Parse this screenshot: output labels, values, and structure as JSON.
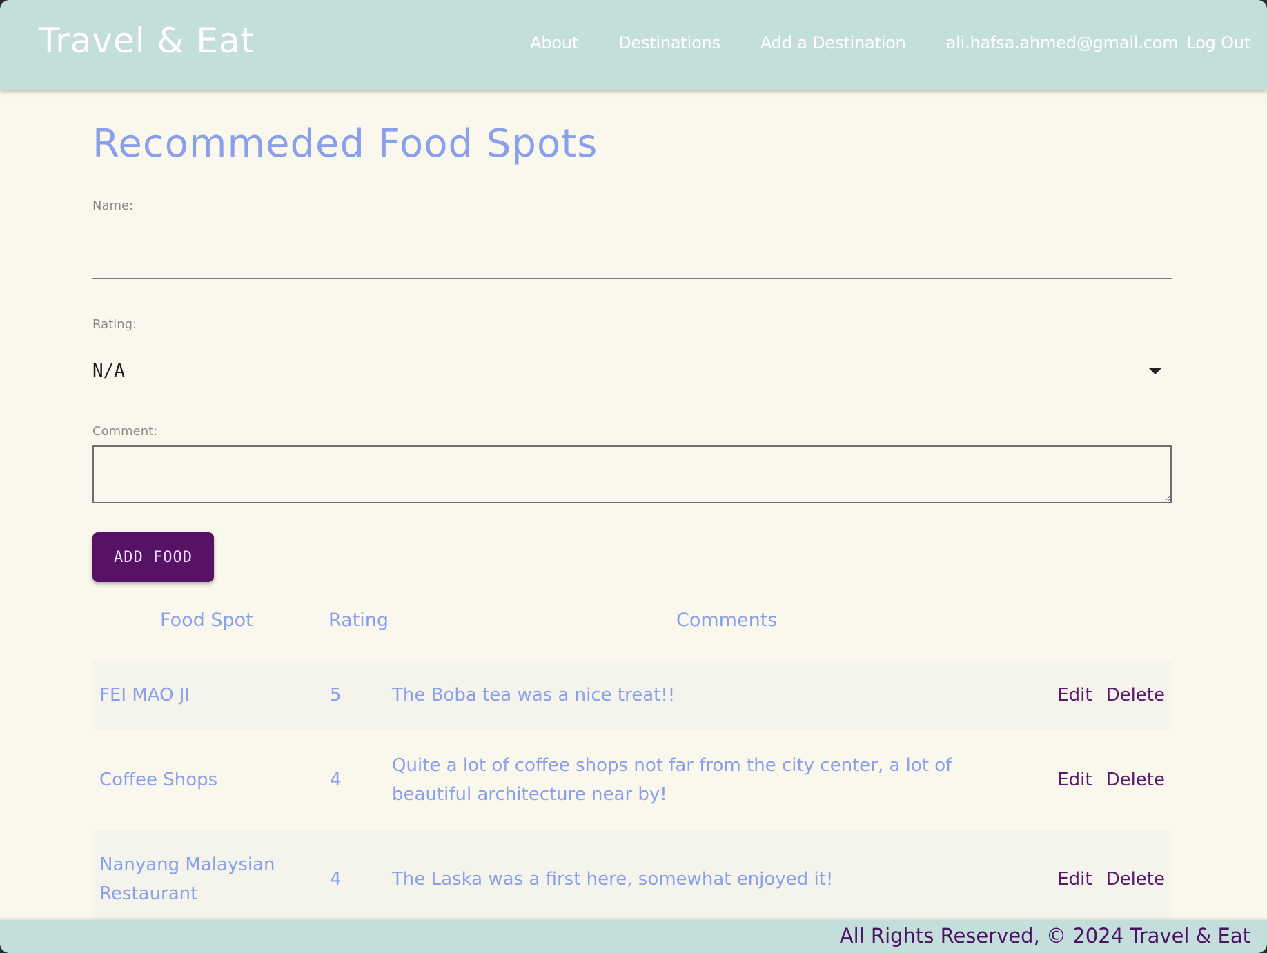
{
  "navbar": {
    "brand": "Travel & Eat",
    "links": {
      "about": "About",
      "destinations": "Destinations",
      "add_destination": "Add a Destination",
      "user_email": "ali.hafsa.ahmed@gmail.com",
      "logout": "Log Out"
    }
  },
  "page": {
    "title": "Recommeded Food Spots"
  },
  "form": {
    "name_label": "Name:",
    "name_value": "",
    "rating_label": "Rating:",
    "rating_value": "N/A",
    "comment_label": "Comment:",
    "comment_value": "",
    "submit_label": "ADD FOOD"
  },
  "table": {
    "headers": {
      "food": "Food Spot",
      "rating": "Rating",
      "comments": "Comments"
    },
    "rows": [
      {
        "food": "FEI MAO JI",
        "rating": "5",
        "comment": "The Boba tea was a nice treat!!",
        "edit": "Edit",
        "delete": "Delete"
      },
      {
        "food": "Coffee Shops",
        "rating": "4",
        "comment": "Quite a lot of coffee shops not far from the city center, a lot of beautiful architecture near by!",
        "edit": "Edit",
        "delete": "Delete"
      },
      {
        "food": "Nanyang Malaysian Restaurant",
        "rating": "4",
        "comment": "The Laska was a first here, somewhat enjoyed it!",
        "edit": "Edit",
        "delete": "Delete"
      }
    ]
  },
  "footer": {
    "text": "All Rights Reserved, © 2024 Travel & Eat"
  },
  "colors": {
    "nav_bg": "#c4dfdb",
    "page_bg": "#faf8ec",
    "accent_blue": "#8aa0ea",
    "button_purple": "#561264",
    "action_purple": "#5a1a6b"
  }
}
